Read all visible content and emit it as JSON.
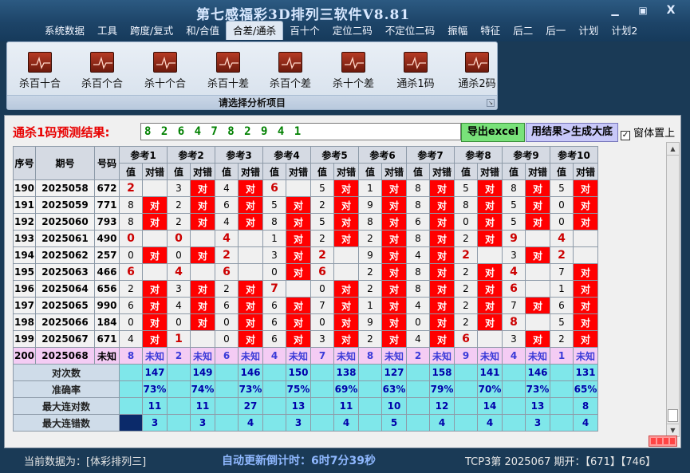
{
  "app": {
    "title": "第七感福彩3D排列三软件V8.81"
  },
  "window_controls": {
    "minimize": "▁",
    "maximize": "▣",
    "close": "X"
  },
  "menu": [
    "系统数据",
    "工具",
    "跨度/复式",
    "和/合值",
    "合差/通杀",
    "百十个",
    "定位二码",
    "不定位二码",
    "振幅",
    "特征",
    "后二",
    "后一",
    "计划",
    "计划2"
  ],
  "menu_active_index": 4,
  "ribbon": {
    "buttons": [
      "杀百十合",
      "杀百个合",
      "杀十个合",
      "杀百十差",
      "杀百个差",
      "杀十个差",
      "通杀1码",
      "通杀2码"
    ],
    "caption": "请选择分析项目",
    "icon": "chart-icon"
  },
  "prediction": {
    "label": "通杀1码预测结果:",
    "value": "8 2 6 4 7 8 2 9 4 1",
    "export_button": "导出excel",
    "generate_button": "用结果>生成大底",
    "on_top_label": "窗体置上",
    "on_top_checked": "✓"
  },
  "table": {
    "col_seq": "序号",
    "col_period": "期号",
    "col_num": "号码",
    "ref_headers": [
      "参考1",
      "参考2",
      "参考3",
      "参考4",
      "参考5",
      "参考6",
      "参考7",
      "参考8",
      "参考9",
      "参考10"
    ],
    "sub_val": "值",
    "sub_check": "对错",
    "check_text": "对",
    "rows": [
      {
        "seq": "190",
        "period": "2025058",
        "num": "672",
        "v": [
          "2",
          "3",
          "4",
          "6",
          "5",
          "1",
          "8",
          "5",
          "8",
          "5"
        ],
        "hit": [
          0,
          1,
          1,
          0,
          1,
          1,
          1,
          1,
          1,
          1
        ]
      },
      {
        "seq": "191",
        "period": "2025059",
        "num": "771",
        "v": [
          "8",
          "2",
          "6",
          "5",
          "2",
          "9",
          "8",
          "8",
          "5",
          "0"
        ],
        "hit": [
          1,
          1,
          1,
          1,
          1,
          1,
          1,
          1,
          1,
          1
        ]
      },
      {
        "seq": "192",
        "period": "2025060",
        "num": "793",
        "v": [
          "8",
          "2",
          "4",
          "8",
          "5",
          "8",
          "6",
          "0",
          "5",
          "0"
        ],
        "hit": [
          1,
          1,
          1,
          1,
          1,
          1,
          1,
          1,
          1,
          1
        ]
      },
      {
        "seq": "193",
        "period": "2025061",
        "num": "490",
        "v": [
          "0",
          "0",
          "4",
          "1",
          "2",
          "2",
          "8",
          "2",
          "9",
          "4"
        ],
        "hit": [
          0,
          0,
          0,
          1,
          1,
          1,
          1,
          1,
          0,
          0
        ]
      },
      {
        "seq": "194",
        "period": "2025062",
        "num": "257",
        "v": [
          "0",
          "0",
          "2",
          "3",
          "2",
          "9",
          "4",
          "2",
          "3",
          "2"
        ],
        "hit": [
          1,
          1,
          0,
          1,
          0,
          1,
          1,
          0,
          1,
          0
        ]
      },
      {
        "seq": "195",
        "period": "2025063",
        "num": "466",
        "v": [
          "6",
          "4",
          "6",
          "0",
          "6",
          "2",
          "8",
          "2",
          "4",
          "7"
        ],
        "hit": [
          0,
          0,
          0,
          1,
          0,
          1,
          1,
          1,
          0,
          1
        ]
      },
      {
        "seq": "196",
        "period": "2025064",
        "num": "656",
        "v": [
          "2",
          "3",
          "2",
          "7",
          "0",
          "2",
          "8",
          "2",
          "6",
          "1"
        ],
        "hit": [
          1,
          1,
          1,
          0,
          1,
          1,
          1,
          1,
          0,
          1
        ]
      },
      {
        "seq": "197",
        "period": "2025065",
        "num": "990",
        "v": [
          "6",
          "4",
          "6",
          "6",
          "7",
          "1",
          "4",
          "2",
          "7",
          "6"
        ],
        "hit": [
          1,
          1,
          1,
          1,
          1,
          1,
          1,
          1,
          1,
          1
        ]
      },
      {
        "seq": "198",
        "period": "2025066",
        "num": "184",
        "v": [
          "0",
          "0",
          "0",
          "6",
          "0",
          "9",
          "0",
          "2",
          "8",
          "5"
        ],
        "hit": [
          1,
          1,
          1,
          1,
          1,
          1,
          1,
          1,
          0,
          1
        ]
      },
      {
        "seq": "199",
        "period": "2025067",
        "num": "671",
        "v": [
          "4",
          "1",
          "0",
          "6",
          "3",
          "2",
          "4",
          "6",
          "3",
          "2"
        ],
        "hit": [
          1,
          0,
          1,
          1,
          1,
          1,
          1,
          0,
          1,
          1
        ]
      }
    ],
    "unknown_row": {
      "seq": "200",
      "period": "2025068",
      "num": "未知",
      "v": [
        "8",
        "2",
        "6",
        "4",
        "7",
        "8",
        "2",
        "9",
        "4",
        "1"
      ],
      "check": "未知"
    },
    "stats": [
      {
        "label": "对次数",
        "values": [
          "147",
          "149",
          "146",
          "150",
          "138",
          "127",
          "158",
          "141",
          "146",
          "131"
        ]
      },
      {
        "label": "准确率",
        "values": [
          "73%",
          "74%",
          "73%",
          "75%",
          "69%",
          "63%",
          "79%",
          "70%",
          "73%",
          "65%"
        ]
      },
      {
        "label": "最大连对数",
        "values": [
          "11",
          "11",
          "27",
          "13",
          "11",
          "10",
          "12",
          "14",
          "13",
          "8"
        ]
      },
      {
        "label": "最大连错数",
        "values": [
          "3",
          "3",
          "4",
          "3",
          "4",
          "5",
          "4",
          "4",
          "3",
          "4"
        ]
      }
    ]
  },
  "status": {
    "source_label": "当前数据为：[体彩排列三]",
    "countdown_label": "自动更新倒计时：",
    "countdown_value": "6时7分39秒",
    "draw_info": "TCP3第 2025067 期开：【671】【746】"
  },
  "colors": {
    "hit": "#ff0000",
    "unknown_row": "#f4ccf4",
    "stats_bg": "#7fe7ea",
    "prediction_text": "#008000"
  }
}
